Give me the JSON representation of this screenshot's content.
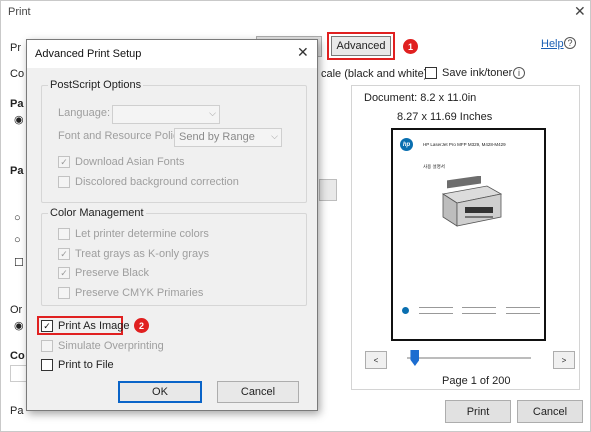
{
  "main_window": {
    "title": "Print",
    "advanced_label": "Advanced",
    "help_label": "Help",
    "grayscale_label": "cale (black and white)",
    "save_ink_label": "Save ink/toner",
    "document_size": "Document: 8.2 x 11.0in",
    "paper_size": "8.27 x 11.69 Inches",
    "page_counter": "Page 1 of 200",
    "print_label": "Print",
    "cancel_label": "Cancel",
    "left_slivers": [
      "Pr",
      "Co",
      "Pa",
      "Pa",
      "Or",
      "Co",
      "Pa"
    ],
    "annotation_badges": [
      "1",
      "2"
    ],
    "slider_position": 0.03
  },
  "preview_page": {
    "title": "HP LaserJet Pro MFP M329, M428-M429",
    "subtitle": "사용 설명서"
  },
  "advanced_dialog": {
    "title": "Advanced Print Setup",
    "postscript_group": {
      "legend": "PostScript Options",
      "language_label": "Language:",
      "language_value": "",
      "font_policy_label": "Font and Resource Policy:",
      "font_policy_value": "Send by Range",
      "options": [
        {
          "label": "Download Asian Fonts",
          "checked": true,
          "enabled": false
        },
        {
          "label": "Discolored background correction",
          "checked": false,
          "enabled": false
        }
      ]
    },
    "color_group": {
      "legend": "Color Management",
      "options": [
        {
          "label": "Let printer determine colors",
          "checked": false,
          "enabled": false
        },
        {
          "label": "Treat grays as K-only grays",
          "checked": true,
          "enabled": false
        },
        {
          "label": "Preserve Black",
          "checked": true,
          "enabled": false
        },
        {
          "label": "Preserve CMYK Primaries",
          "checked": false,
          "enabled": false
        }
      ]
    },
    "print_as_image": {
      "label": "Print As Image",
      "checked": true
    },
    "simulate_overprinting": {
      "label": "Simulate Overprinting",
      "checked": false,
      "enabled": false
    },
    "print_to_file": {
      "label": "Print to File",
      "checked": false
    },
    "ok_label": "OK",
    "cancel_label": "Cancel"
  },
  "colors": {
    "highlight_red": "#e02020",
    "link_blue": "#1a5fb4",
    "focus_blue": "#0a64c8"
  }
}
